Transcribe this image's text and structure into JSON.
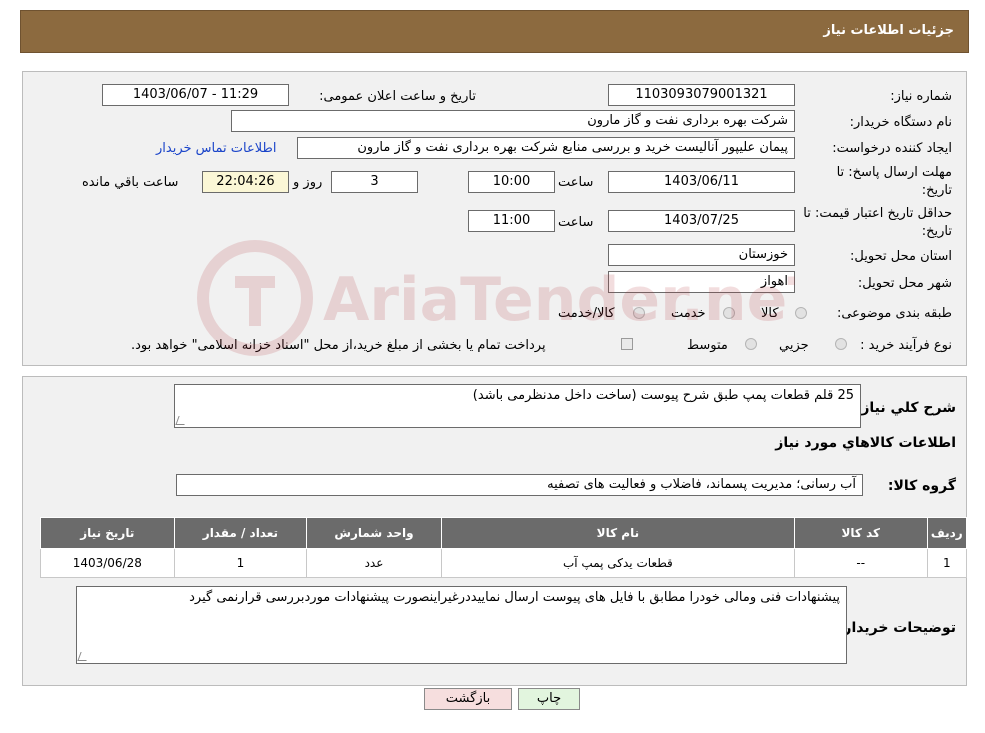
{
  "header": {
    "title": "جزئیات اطلاعات نیاز"
  },
  "form": {
    "need_number_label": "شماره نیاز:",
    "need_number": "1103093079001321",
    "announce_label": "تاریخ و ساعت اعلان عمومی:",
    "announce_value": "1403/06/07 - 11:29",
    "buyer_org_label": "نام دستگاه خریدار:",
    "buyer_org": "شرکت بهره برداری نفت و گاز مارون",
    "creator_label": "ایجاد کننده درخواست:",
    "creator": "پیمان علیپور آنالیست خرید و بررسی منابع شرکت بهره برداری نفت و گاز مارون",
    "contact_link": "اطلاعات تماس خریدار",
    "deadline_label_1": "مهلت ارسال پاسخ: تا",
    "deadline_label_2": "تاریخ:",
    "deadline_date": "1403/06/11",
    "time_label": "ساعت",
    "deadline_time": "10:00",
    "days_value": "3",
    "days_label": "روز و",
    "remaining_value": "22:04:26",
    "remaining_label": "ساعت باقي مانده",
    "validity_label_1": "حداقل تاریخ اعتبار قیمت: تا",
    "validity_label_2": "تاریخ:",
    "validity_date": "1403/07/25",
    "validity_time": "11:00",
    "province_label": "استان محل تحویل:",
    "province": "خوزستان",
    "city_label": "شهر محل تحویل:",
    "city": "اهواز",
    "category_label": "طبقه بندی موضوعی:",
    "category_options": [
      "کالا",
      "خدمت",
      "کالا/خدمت"
    ],
    "process_label": "نوع فرآیند خرید :",
    "process_options": [
      "جزیي",
      "متوسط"
    ],
    "payment_note": "پرداخت تمام یا بخشی از مبلغ خرید،از محل \"اسناد خزانه اسلامی\" خواهد بود."
  },
  "details": {
    "desc_label": "شرح کلي نياز:",
    "desc_value": "25 قلم قطعات پمپ طبق شرح پیوست (ساخت داخل مدنظرمی باشد)",
    "goods_title": "اطلاعات کالاهاي مورد نياز",
    "group_label": "گروه کالا:",
    "group_value": "آب رسانی؛ مدیریت پسماند، فاضلاب و فعالیت های تصفیه",
    "table": {
      "headers": [
        "رديف",
        "کد کالا",
        "نام کالا",
        "واحد شمارش",
        "تعداد / مقدار",
        "تاریخ نیاز"
      ],
      "rows": [
        [
          "1",
          "--",
          "قطعات یدکی پمپ آب",
          "عدد",
          "1",
          "1403/06/28"
        ]
      ]
    },
    "buyer_notes_label": "توضیحات خریدار:",
    "buyer_notes": "پیشنهادات فنی ومالی خودرا  مطابق با فایل های پیوست ارسال نماییددرغیراینصورت پیشنهادات موردبررسی قرارنمی گیرد"
  },
  "buttons": {
    "print": "چاپ",
    "back": "بازگشت"
  },
  "watermark": {
    "text": "AriaTender.neT"
  },
  "colors": {
    "header_bg": "#8c6a3f",
    "link": "#1a44c9",
    "table_header": "#6b6b6b",
    "back_button": "#f6dede",
    "print_button": "#e2f5de"
  }
}
